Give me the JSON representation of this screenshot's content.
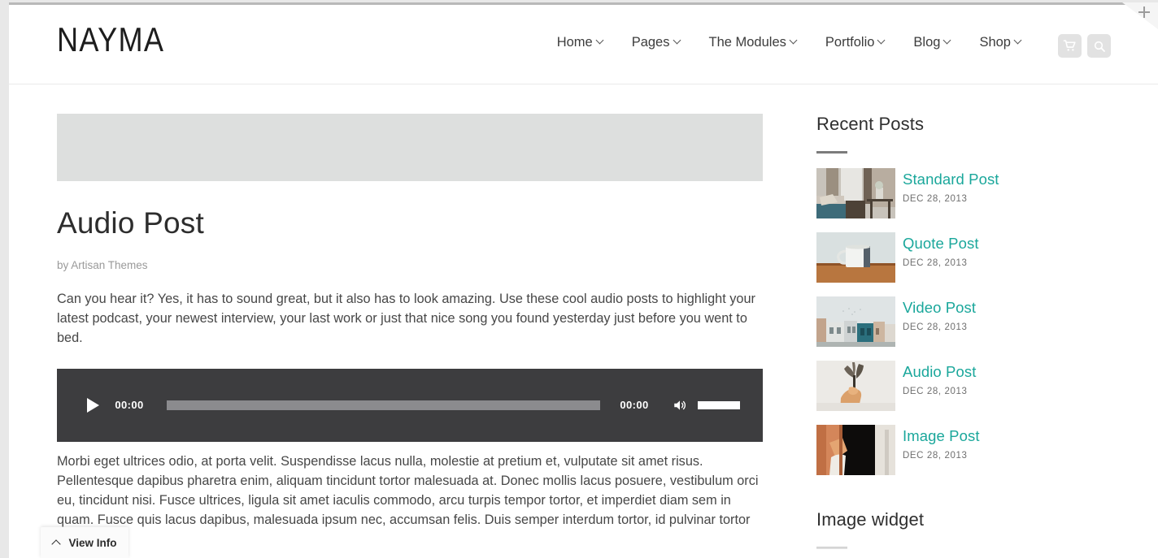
{
  "site": {
    "logo": "NAYMA"
  },
  "header": {
    "nav": [
      {
        "label": "Home",
        "has_dropdown": true
      },
      {
        "label": "Pages",
        "has_dropdown": true
      },
      {
        "label": "The Modules",
        "has_dropdown": true
      },
      {
        "label": "Portfolio",
        "has_dropdown": true
      },
      {
        "label": "Blog",
        "has_dropdown": true
      },
      {
        "label": "Shop",
        "has_dropdown": true
      }
    ],
    "icons": [
      {
        "name": "cart-icon",
        "title": "Cart"
      },
      {
        "name": "search-icon",
        "title": "Search"
      }
    ],
    "corner": {
      "name": "plus-icon",
      "title": "Open panel"
    }
  },
  "post": {
    "title": "Audio Post",
    "meta": "by Artisan Themes",
    "intro": "Can you hear it? Yes, it has to sound great, but it also has to look amazing. Use these cool audio posts to highlight your latest podcast, your newest interview, your last work or just that nice song you found yesterday just before you went to bed.",
    "body": "Morbi eget ultrices odio, at porta velit. Suspendisse lacus nulla, molestie at pretium et, vulputate sit amet risus. Pellentesque dapibus pharetra enim, aliquam tincidunt tortor malesuada at. Donec mollis lacus posuere, vestibulum orci eu, tincidunt nisi. Fusce ultrices, ligula sit amet iaculis commodo, arcu turpis tempor tortor, et imperdiet diam sem in quam. Fusce quis lacus dapibus, malesuada ipsum nec, accumsan felis. Duis semper interdum tortor, id pulvinar tortor tempor non."
  },
  "audio_player": {
    "play_label": "Play",
    "current_time": "00:00",
    "duration": "00:00",
    "progress_percent": 0,
    "volume_percent": 100,
    "mute_label": "Mute"
  },
  "sidebar": {
    "widgets": [
      {
        "title": "Recent Posts",
        "type": "recent-posts",
        "posts": [
          {
            "title": "Standard Post",
            "date": "DEC 28, 2013",
            "thumb": "living-room"
          },
          {
            "title": "Quote Post",
            "date": "DEC 28, 2013",
            "thumb": "white-mug"
          },
          {
            "title": "Video Post",
            "date": "DEC 28, 2013",
            "thumb": "street-buildings"
          },
          {
            "title": "Audio Post",
            "date": "DEC 28, 2013",
            "thumb": "dried-flowers"
          },
          {
            "title": "Image Post",
            "date": "DEC 28, 2013",
            "thumb": "orange-doorway"
          }
        ]
      },
      {
        "title": "Image widget",
        "type": "image",
        "posts": []
      }
    ]
  },
  "overlay": {
    "view_info_label": "View Info",
    "view_info_icon": "chevron-up-icon"
  },
  "colors": {
    "accent": "#1aa79b",
    "text": "#3a3a3a",
    "muted": "#9a9a9a",
    "player_bg": "#3d3d3f",
    "page_bg": "#e8e8e8",
    "placeholder": "#dddfde"
  }
}
